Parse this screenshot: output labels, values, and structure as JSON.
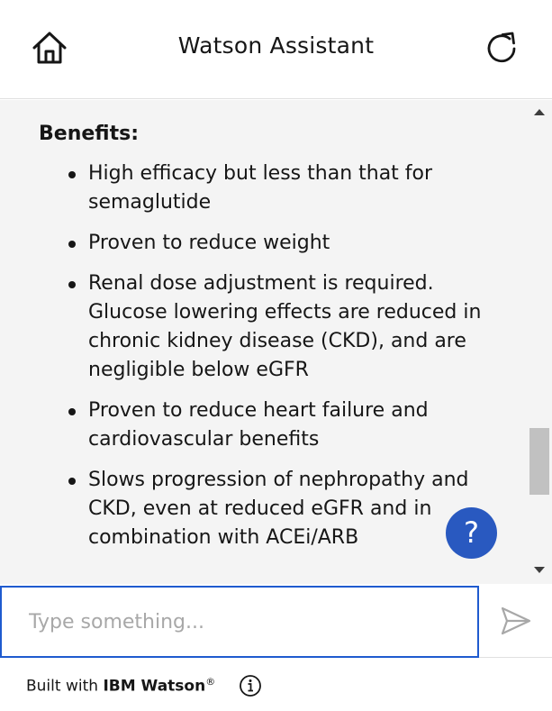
{
  "header": {
    "title": "Watson Assistant",
    "home_icon": "home-icon",
    "restart_icon": "restart-icon"
  },
  "message": {
    "heading": "Benefits:",
    "bullets": [
      "High efficacy but less than that for semaglutide",
      "Proven to reduce weight",
      "Renal dose adjustment is required. Glucose lowering effects are reduced in chronic kidney disease (CKD), and are negligible below eGFR",
      "Proven to reduce heart failure and cardiovascular benefits",
      "Slows progression of nephropathy and CKD, even at reduced eGFR and in combination with ACEi/ARB"
    ]
  },
  "help": {
    "label": "?"
  },
  "input": {
    "placeholder": "Type something...",
    "value": ""
  },
  "footer": {
    "built_with": "Built with ",
    "brand": "IBM Watson",
    "registered": "®"
  },
  "colors": {
    "accent": "#2959c0",
    "input_border": "#1f5bcf",
    "content_bg": "#f4f4f4"
  }
}
